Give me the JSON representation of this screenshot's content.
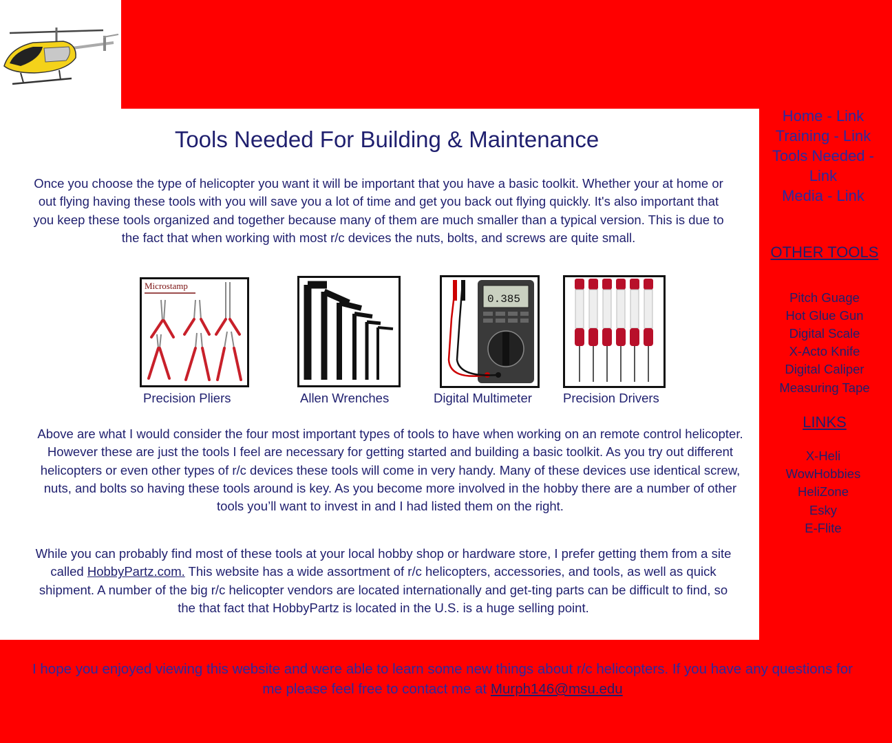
{
  "header": {
    "logo_icon": "rc-helicopter-photo"
  },
  "main": {
    "title": "Tools Needed For Building & Maintenance",
    "intro": "Once you choose the type of helicopter you want it will be important that you have a basic toolkit. Whether your at home or out flying having these tools with you will save you a lot of time and get you back out flying quickly. It's also important that you keep these tools organized and together because many of them are much smaller than a typical version. This is due to the fact that when working with most r/c devices the nuts, bolts, and screws are quite small.",
    "tools": [
      {
        "label": "Precision Pliers",
        "image_text": "Microstamp",
        "icon": "pliers-photo"
      },
      {
        "label": "Allen Wrenches",
        "icon": "allen-wrench-photo"
      },
      {
        "label": "Digital Multimeter",
        "image_text": "0.385",
        "icon": "multimeter-photo"
      },
      {
        "label": "Precision Drivers",
        "icon": "screwdriver-photo"
      }
    ],
    "para2": "Above are what I would consider the four most important types of tools to have when working on an remote control helicopter. However  these are just the tools I feel are necessary for getting started and building a basic toolkit. As you try out different helicopters or even other types of r/c devices these tools will come in very handy. Many of these devices use identical screw, nuts, and bolts so having these tools around is key. As you become more involved in the hobby there are a number of other tools you’ll want to invest in and I had listed them on the right.",
    "para3_before": "While you can probably find most of these tools at your local hobby shop or hardware store, I prefer getting them from a site called ",
    "para3_link": "HobbyPartz.com.",
    "para3_after": " This website has a wide assortment of r/c helicopters, accessories, and tools, as well as quick shipment. A number of the big r/c helicopter vendors are located internationally and get-ting parts can be difficult to find, so the that fact that HobbyPartz is located in the U.S. is a huge selling point."
  },
  "sidebar": {
    "nav": [
      "Home - Link",
      "Training - Link",
      "Tools Needed - Link",
      "Media - Link"
    ],
    "other_tools_heading": "OTHER TOOLS",
    "other_tools": [
      "Pitch Guage",
      "Hot Glue Gun",
      "Digital Scale",
      "X-Acto Knife",
      "Digital Caliper",
      "Measuring Tape"
    ],
    "links_heading": "LINKS",
    "links": [
      "X-Heli",
      "WowHobbies",
      "HeliZone",
      "Esky",
      "E-Flite"
    ]
  },
  "footer": {
    "text": "I hope you enjoyed viewing this website and were able to learn some new things about r/c helicopters. If you have any questions for me please feel free to contact me at ",
    "email": "Murph146@msu.edu"
  },
  "colors": {
    "background": "#ff0000",
    "text": "#1f1f6e",
    "link": "#2a2aa0",
    "content_bg": "#ffffff"
  }
}
